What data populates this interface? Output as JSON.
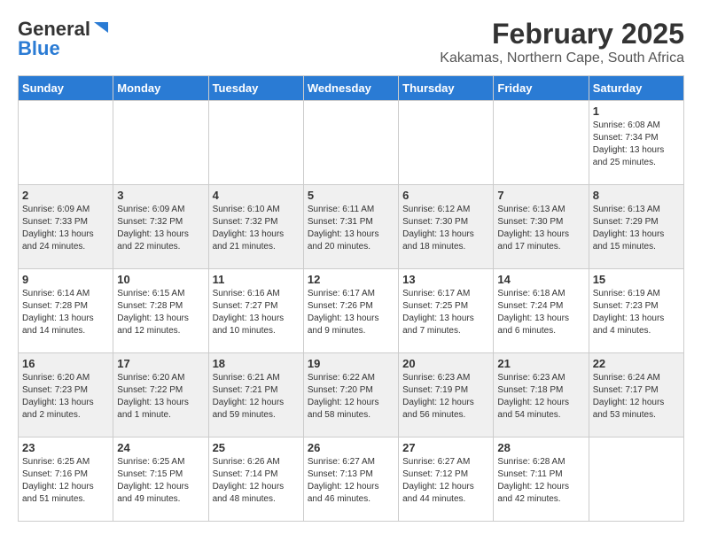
{
  "header": {
    "logo_line1": "General",
    "logo_line2": "Blue",
    "month": "February 2025",
    "location": "Kakamas, Northern Cape, South Africa"
  },
  "weekdays": [
    "Sunday",
    "Monday",
    "Tuesday",
    "Wednesday",
    "Thursday",
    "Friday",
    "Saturday"
  ],
  "weeks": [
    [
      {
        "day": "",
        "info": ""
      },
      {
        "day": "",
        "info": ""
      },
      {
        "day": "",
        "info": ""
      },
      {
        "day": "",
        "info": ""
      },
      {
        "day": "",
        "info": ""
      },
      {
        "day": "",
        "info": ""
      },
      {
        "day": "1",
        "info": "Sunrise: 6:08 AM\nSunset: 7:34 PM\nDaylight: 13 hours\nand 25 minutes."
      }
    ],
    [
      {
        "day": "2",
        "info": "Sunrise: 6:09 AM\nSunset: 7:33 PM\nDaylight: 13 hours\nand 24 minutes."
      },
      {
        "day": "3",
        "info": "Sunrise: 6:09 AM\nSunset: 7:32 PM\nDaylight: 13 hours\nand 22 minutes."
      },
      {
        "day": "4",
        "info": "Sunrise: 6:10 AM\nSunset: 7:32 PM\nDaylight: 13 hours\nand 21 minutes."
      },
      {
        "day": "5",
        "info": "Sunrise: 6:11 AM\nSunset: 7:31 PM\nDaylight: 13 hours\nand 20 minutes."
      },
      {
        "day": "6",
        "info": "Sunrise: 6:12 AM\nSunset: 7:30 PM\nDaylight: 13 hours\nand 18 minutes."
      },
      {
        "day": "7",
        "info": "Sunrise: 6:13 AM\nSunset: 7:30 PM\nDaylight: 13 hours\nand 17 minutes."
      },
      {
        "day": "8",
        "info": "Sunrise: 6:13 AM\nSunset: 7:29 PM\nDaylight: 13 hours\nand 15 minutes."
      }
    ],
    [
      {
        "day": "9",
        "info": "Sunrise: 6:14 AM\nSunset: 7:28 PM\nDaylight: 13 hours\nand 14 minutes."
      },
      {
        "day": "10",
        "info": "Sunrise: 6:15 AM\nSunset: 7:28 PM\nDaylight: 13 hours\nand 12 minutes."
      },
      {
        "day": "11",
        "info": "Sunrise: 6:16 AM\nSunset: 7:27 PM\nDaylight: 13 hours\nand 10 minutes."
      },
      {
        "day": "12",
        "info": "Sunrise: 6:17 AM\nSunset: 7:26 PM\nDaylight: 13 hours\nand 9 minutes."
      },
      {
        "day": "13",
        "info": "Sunrise: 6:17 AM\nSunset: 7:25 PM\nDaylight: 13 hours\nand 7 minutes."
      },
      {
        "day": "14",
        "info": "Sunrise: 6:18 AM\nSunset: 7:24 PM\nDaylight: 13 hours\nand 6 minutes."
      },
      {
        "day": "15",
        "info": "Sunrise: 6:19 AM\nSunset: 7:23 PM\nDaylight: 13 hours\nand 4 minutes."
      }
    ],
    [
      {
        "day": "16",
        "info": "Sunrise: 6:20 AM\nSunset: 7:23 PM\nDaylight: 13 hours\nand 2 minutes."
      },
      {
        "day": "17",
        "info": "Sunrise: 6:20 AM\nSunset: 7:22 PM\nDaylight: 13 hours\nand 1 minute."
      },
      {
        "day": "18",
        "info": "Sunrise: 6:21 AM\nSunset: 7:21 PM\nDaylight: 12 hours\nand 59 minutes."
      },
      {
        "day": "19",
        "info": "Sunrise: 6:22 AM\nSunset: 7:20 PM\nDaylight: 12 hours\nand 58 minutes."
      },
      {
        "day": "20",
        "info": "Sunrise: 6:23 AM\nSunset: 7:19 PM\nDaylight: 12 hours\nand 56 minutes."
      },
      {
        "day": "21",
        "info": "Sunrise: 6:23 AM\nSunset: 7:18 PM\nDaylight: 12 hours\nand 54 minutes."
      },
      {
        "day": "22",
        "info": "Sunrise: 6:24 AM\nSunset: 7:17 PM\nDaylight: 12 hours\nand 53 minutes."
      }
    ],
    [
      {
        "day": "23",
        "info": "Sunrise: 6:25 AM\nSunset: 7:16 PM\nDaylight: 12 hours\nand 51 minutes."
      },
      {
        "day": "24",
        "info": "Sunrise: 6:25 AM\nSunset: 7:15 PM\nDaylight: 12 hours\nand 49 minutes."
      },
      {
        "day": "25",
        "info": "Sunrise: 6:26 AM\nSunset: 7:14 PM\nDaylight: 12 hours\nand 48 minutes."
      },
      {
        "day": "26",
        "info": "Sunrise: 6:27 AM\nSunset: 7:13 PM\nDaylight: 12 hours\nand 46 minutes."
      },
      {
        "day": "27",
        "info": "Sunrise: 6:27 AM\nSunset: 7:12 PM\nDaylight: 12 hours\nand 44 minutes."
      },
      {
        "day": "28",
        "info": "Sunrise: 6:28 AM\nSunset: 7:11 PM\nDaylight: 12 hours\nand 42 minutes."
      },
      {
        "day": "",
        "info": ""
      }
    ]
  ]
}
